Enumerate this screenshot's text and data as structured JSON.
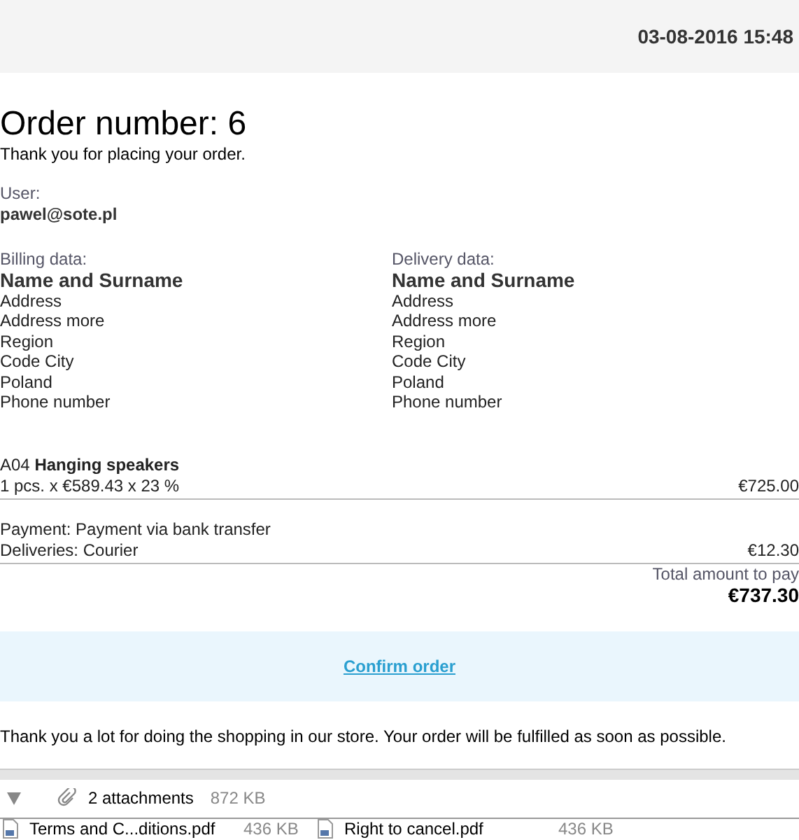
{
  "header": {
    "date": "03-08-2016 15:48"
  },
  "order": {
    "title": "Order number: 6",
    "thanks": "Thank you for placing your order.",
    "user_label": "User:",
    "user": "pawel@sote.pl"
  },
  "addresses": [
    {
      "label": "Billing data:",
      "name": "Name and Surname",
      "lines": [
        "Address",
        "Address more",
        "Region",
        "Code City",
        "Poland",
        "Phone number"
      ]
    },
    {
      "label": "Delivery data:",
      "name": "Name and Surname",
      "lines": [
        "Address",
        "Address more",
        "Region",
        "Code City",
        "Poland",
        "Phone number"
      ]
    }
  ],
  "item": {
    "title": "A04 **Hanging speakers**",
    "detail": "1 pcs. x €589.43 x 23 %",
    "price": "€725.00"
  },
  "payment": "Payment: Payment via bank transfer",
  "delivery": {
    "label": "Deliveries: Courier",
    "price": "€12.30"
  },
  "total": {
    "label": "Total amount to pay",
    "amount": "€737.30"
  },
  "confirm": "Confirm order",
  "footer_text": "Thank you a lot for doing the shopping in our store. Your order will be fulfilled as soon as possible.",
  "attachments": {
    "expanded": true,
    "count": "2 attachments",
    "size": "872 KB",
    "files": [
      {
        "name": "Terms and C...ditions.pdf",
        "size": "436 KB"
      },
      {
        "name": "Right to cancel.pdf",
        "size": "436 KB"
      }
    ]
  }
}
